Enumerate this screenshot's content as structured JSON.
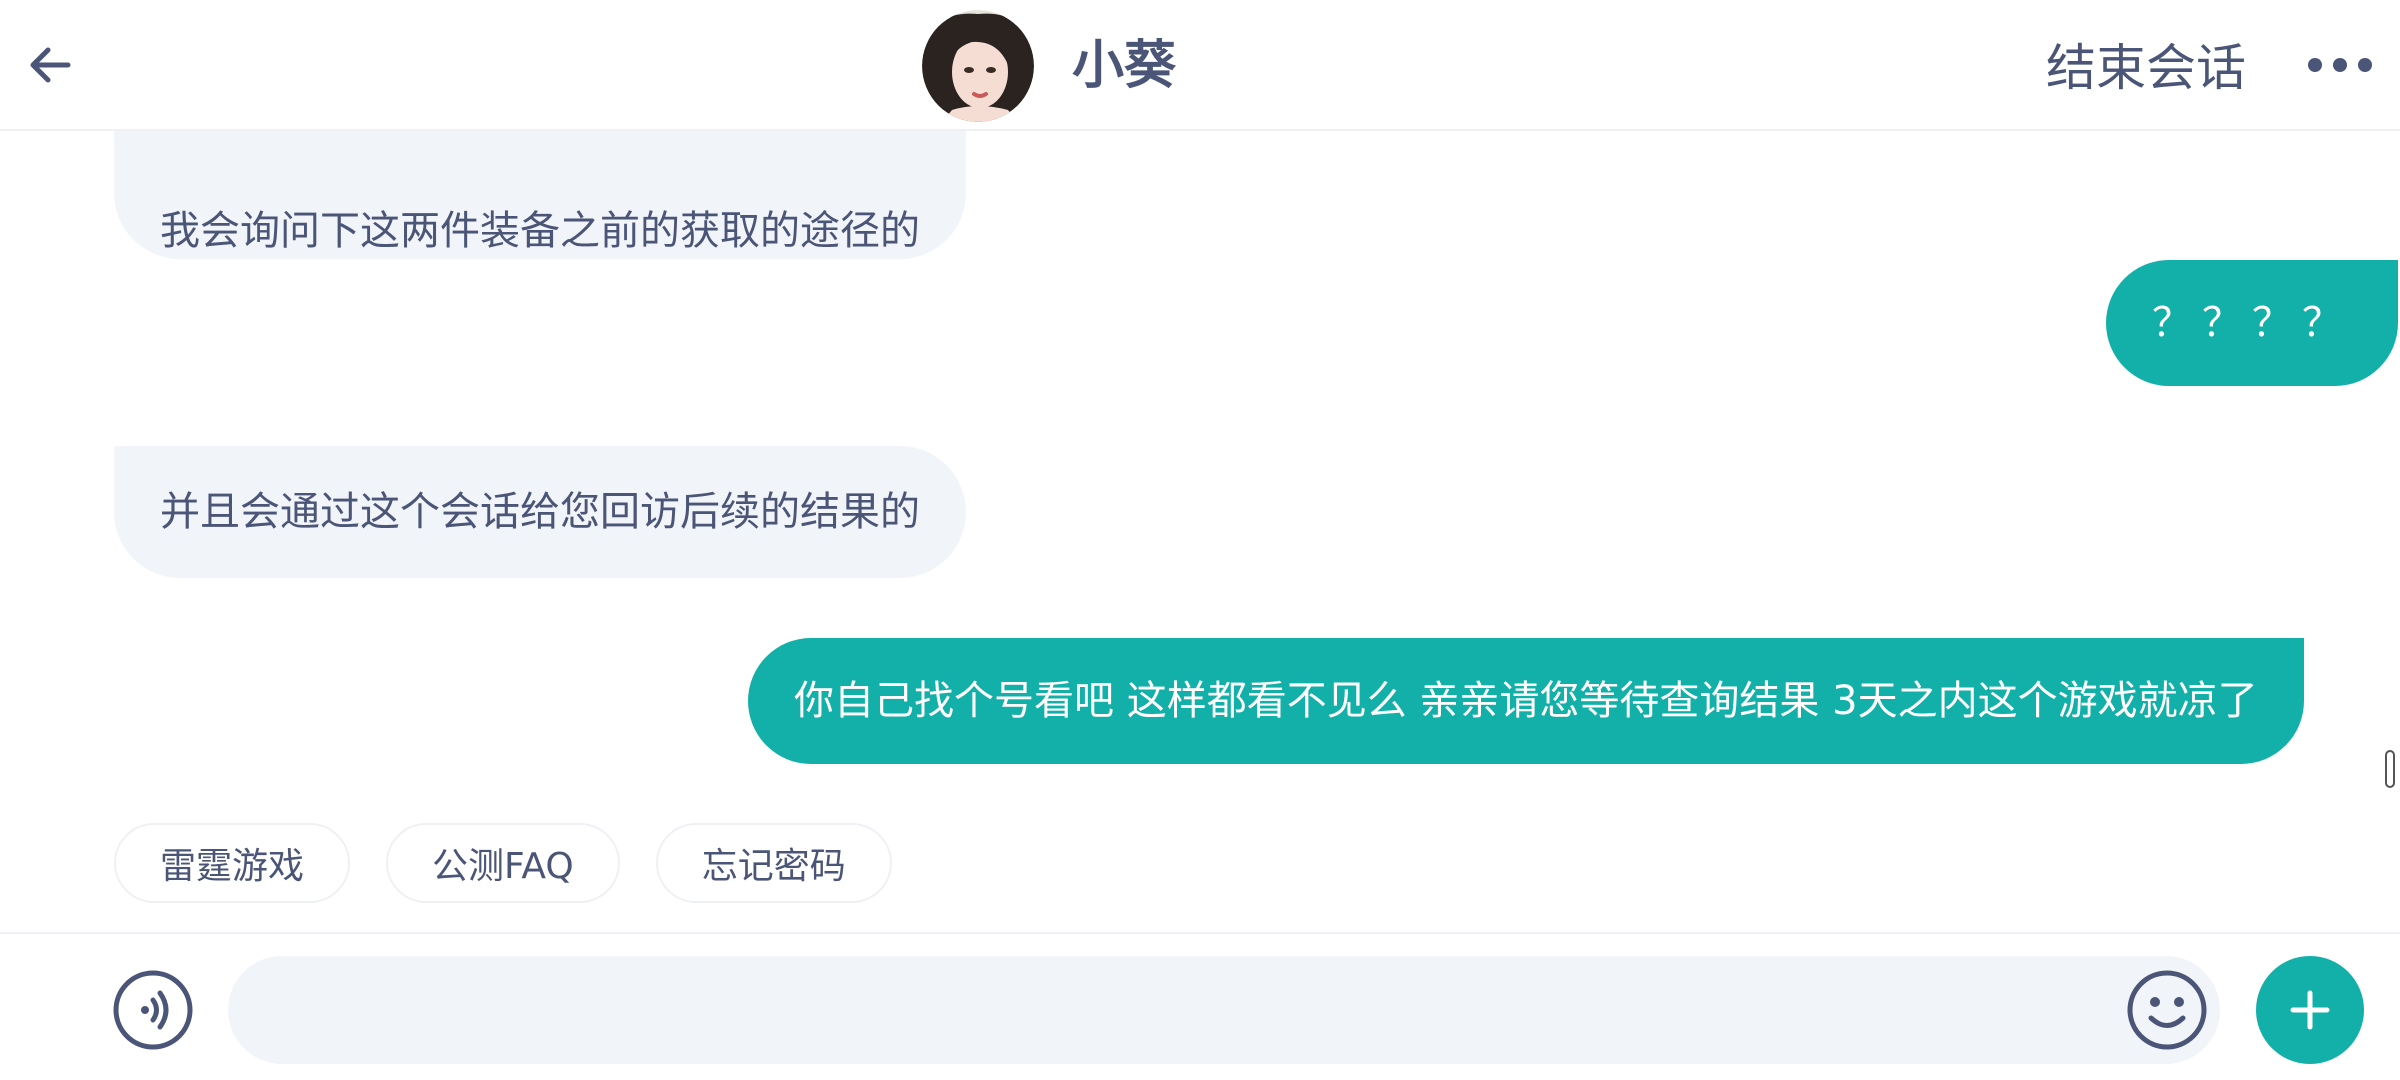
{
  "header": {
    "contact_name": "小葵",
    "end_chat_label": "结束会话",
    "back_icon": "back-arrow-icon",
    "more_icon": "more-dots-icon"
  },
  "messages": [
    {
      "direction": "incoming",
      "text": "我会询问下这两件装备之前的获取的途径的"
    },
    {
      "direction": "outgoing",
      "text": "？？？？"
    },
    {
      "direction": "incoming",
      "text": "并且会通过这个会话给您回访后续的结果的"
    },
    {
      "direction": "outgoing",
      "text": "你自己找个号看吧 这样都看不见么 亲亲请您等待查询结果 3天之内这个游戏就凉了"
    }
  ],
  "quick_replies": [
    "雷霆游戏",
    "公测FAQ",
    "忘记密码"
  ],
  "input": {
    "value": "",
    "placeholder": ""
  },
  "colors": {
    "accent": "#13b0aa",
    "incoming_bubble": "#f1f4f8",
    "text": "#4b5578"
  }
}
